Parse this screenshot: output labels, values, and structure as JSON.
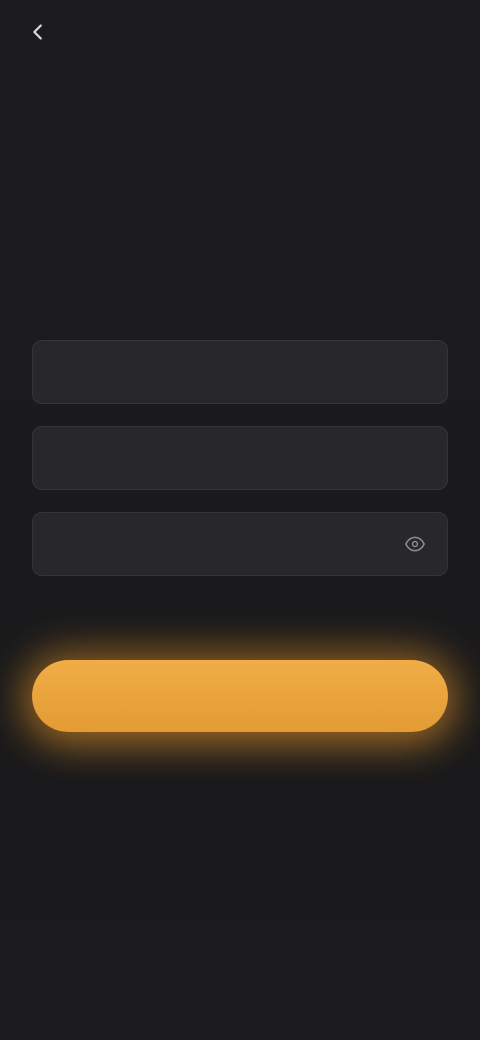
{
  "top_bar": {
    "back_label": ""
  },
  "headline": {
    "accent": "",
    "line1_rest": "",
    "line2": ""
  },
  "subtitle": {
    "text": ""
  },
  "form": {
    "field1": {
      "placeholder": "",
      "value": ""
    },
    "field2": {
      "placeholder": "",
      "value": ""
    },
    "field3": {
      "placeholder": "",
      "value": ""
    }
  },
  "cta": {
    "label": ""
  },
  "footer": {
    "text": "",
    "link": ""
  },
  "colors": {
    "background": "#1b1b1d",
    "field_bg": "#28282c",
    "accent": "#e7a53c",
    "cta_bg": "#eaa33e",
    "link": "#5a8fe6"
  },
  "icons": {
    "back": "arrow-left-icon",
    "field3_trailing": "eye-icon"
  }
}
